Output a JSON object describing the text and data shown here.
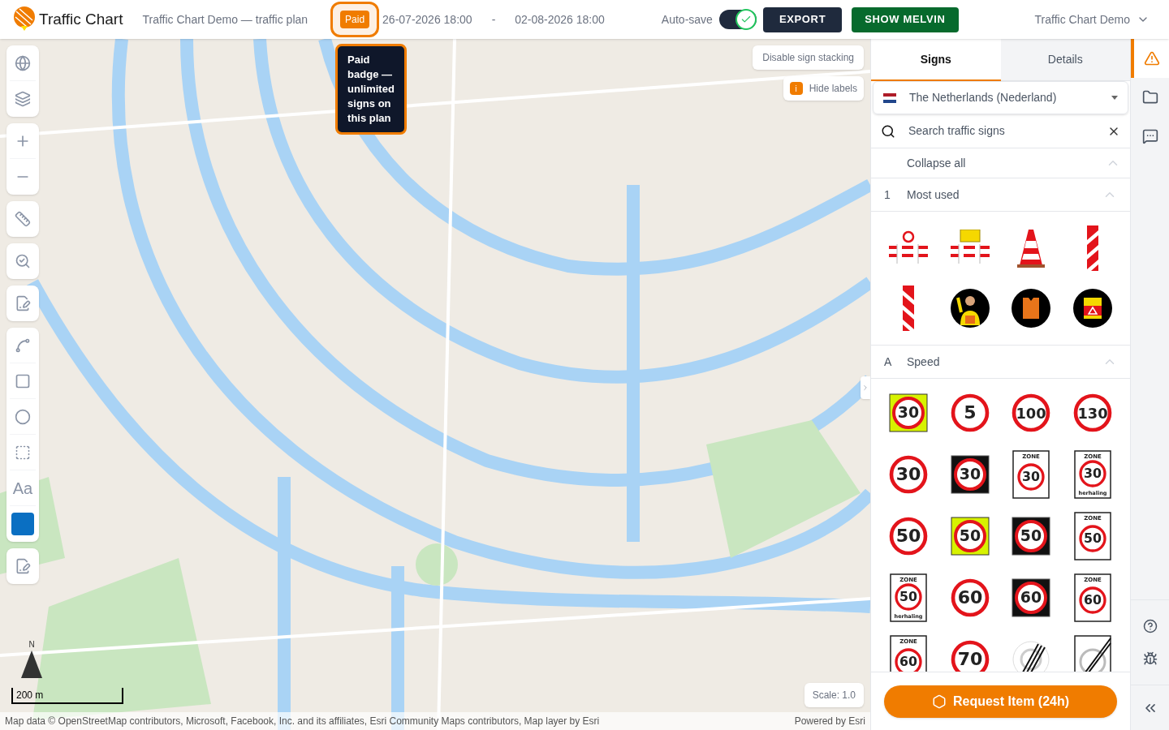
{
  "header": {
    "app_name": "Traffic Chart",
    "plan_title": "Traffic Chart Demo — traffic plan",
    "badge": "Paid",
    "start": "26-07-2026 18:00",
    "separator": "-",
    "end": "02-08-2026 18:00",
    "autosave_label": "Auto-save",
    "autosave_on": true,
    "export": "EXPORT",
    "melvin": "SHOW MELVIN",
    "account": "Traffic Chart Demo"
  },
  "tooltip": "Paid badge — unlimited signs on this plan",
  "map": {
    "text_tool": "Aa",
    "disable_stacking": "Disable sign stacking",
    "hide_labels_badge": "i",
    "hide_labels": "Hide labels",
    "north": "N",
    "scale_bar": "200 m",
    "scale": "Scale: 1.0",
    "attribution": "Map data © OpenStreetMap contributors, Microsoft, Facebook, Inc. and its affiliates, Esri Community Maps contributors, Map layer by Esri",
    "powered": "Powered by Esri"
  },
  "panel": {
    "tabs": [
      {
        "label": "Signs",
        "selected": true
      },
      {
        "label": "Details",
        "selected": false
      }
    ],
    "country": "The Netherlands (Nederland)",
    "search_placeholder": "Search traffic signs",
    "collapse_all": "Collapse all",
    "sections": [
      {
        "code": "1",
        "title": "Most used",
        "expanded": true,
        "signs": [
          {
            "kind": "barrier_closed"
          },
          {
            "kind": "barrier_board"
          },
          {
            "kind": "cone"
          },
          {
            "kind": "post_right"
          },
          {
            "kind": "post_left"
          },
          {
            "kind": "worker_person"
          },
          {
            "kind": "worker_vest"
          },
          {
            "kind": "worker_vest_sign"
          }
        ]
      },
      {
        "code": "A",
        "title": "Speed",
        "expanded": true,
        "signs": [
          {
            "kind": "yellow",
            "number": "30"
          },
          {
            "kind": "plain",
            "number": "5"
          },
          {
            "kind": "plain",
            "number": "100"
          },
          {
            "kind": "plain",
            "number": "130"
          },
          {
            "kind": "plain",
            "number": "30"
          },
          {
            "kind": "black",
            "number": "30"
          },
          {
            "kind": "zone",
            "number": "30",
            "top": "ZONE"
          },
          {
            "kind": "zone",
            "number": "30",
            "top": "ZONE",
            "bottom": "herhaling"
          },
          {
            "kind": "plain",
            "number": "50"
          },
          {
            "kind": "yellow",
            "number": "50"
          },
          {
            "kind": "black",
            "number": "50"
          },
          {
            "kind": "zone",
            "number": "50",
            "top": "ZONE"
          },
          {
            "kind": "zone",
            "number": "50",
            "top": "ZONE",
            "bottom": "herhaling"
          },
          {
            "kind": "plain",
            "number": "60"
          },
          {
            "kind": "black",
            "number": "60"
          },
          {
            "kind": "zone",
            "number": "60",
            "top": "ZONE"
          },
          {
            "kind": "zone",
            "number": "60",
            "top": "ZONE"
          },
          {
            "kind": "plain",
            "number": "70"
          },
          {
            "kind": "end"
          },
          {
            "kind": "end_zone"
          }
        ]
      }
    ],
    "request": "Request Item (24h)"
  },
  "rail": [
    {
      "kind": "warning",
      "selected": true
    },
    {
      "kind": "folder",
      "selected": false
    },
    {
      "kind": "comment",
      "selected": false
    }
  ]
}
